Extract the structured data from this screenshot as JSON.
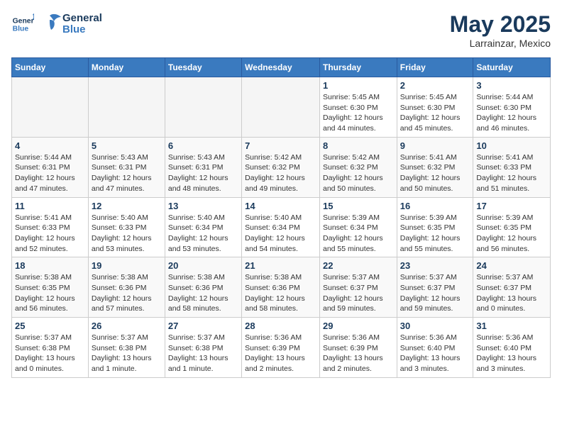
{
  "logo": {
    "line1": "General",
    "line2": "Blue"
  },
  "title": "May 2025",
  "location": "Larrainzar, Mexico",
  "weekdays": [
    "Sunday",
    "Monday",
    "Tuesday",
    "Wednesday",
    "Thursday",
    "Friday",
    "Saturday"
  ],
  "weeks": [
    [
      {
        "day": "",
        "empty": true
      },
      {
        "day": "",
        "empty": true
      },
      {
        "day": "",
        "empty": true
      },
      {
        "day": "",
        "empty": true
      },
      {
        "day": "1",
        "sunrise": "Sunrise: 5:45 AM",
        "sunset": "Sunset: 6:30 PM",
        "daylight": "Daylight: 12 hours and 44 minutes."
      },
      {
        "day": "2",
        "sunrise": "Sunrise: 5:45 AM",
        "sunset": "Sunset: 6:30 PM",
        "daylight": "Daylight: 12 hours and 45 minutes."
      },
      {
        "day": "3",
        "sunrise": "Sunrise: 5:44 AM",
        "sunset": "Sunset: 6:30 PM",
        "daylight": "Daylight: 12 hours and 46 minutes."
      }
    ],
    [
      {
        "day": "4",
        "sunrise": "Sunrise: 5:44 AM",
        "sunset": "Sunset: 6:31 PM",
        "daylight": "Daylight: 12 hours and 47 minutes."
      },
      {
        "day": "5",
        "sunrise": "Sunrise: 5:43 AM",
        "sunset": "Sunset: 6:31 PM",
        "daylight": "Daylight: 12 hours and 47 minutes."
      },
      {
        "day": "6",
        "sunrise": "Sunrise: 5:43 AM",
        "sunset": "Sunset: 6:31 PM",
        "daylight": "Daylight: 12 hours and 48 minutes."
      },
      {
        "day": "7",
        "sunrise": "Sunrise: 5:42 AM",
        "sunset": "Sunset: 6:32 PM",
        "daylight": "Daylight: 12 hours and 49 minutes."
      },
      {
        "day": "8",
        "sunrise": "Sunrise: 5:42 AM",
        "sunset": "Sunset: 6:32 PM",
        "daylight": "Daylight: 12 hours and 50 minutes."
      },
      {
        "day": "9",
        "sunrise": "Sunrise: 5:41 AM",
        "sunset": "Sunset: 6:32 PM",
        "daylight": "Daylight: 12 hours and 50 minutes."
      },
      {
        "day": "10",
        "sunrise": "Sunrise: 5:41 AM",
        "sunset": "Sunset: 6:33 PM",
        "daylight": "Daylight: 12 hours and 51 minutes."
      }
    ],
    [
      {
        "day": "11",
        "sunrise": "Sunrise: 5:41 AM",
        "sunset": "Sunset: 6:33 PM",
        "daylight": "Daylight: 12 hours and 52 minutes."
      },
      {
        "day": "12",
        "sunrise": "Sunrise: 5:40 AM",
        "sunset": "Sunset: 6:33 PM",
        "daylight": "Daylight: 12 hours and 53 minutes."
      },
      {
        "day": "13",
        "sunrise": "Sunrise: 5:40 AM",
        "sunset": "Sunset: 6:34 PM",
        "daylight": "Daylight: 12 hours and 53 minutes."
      },
      {
        "day": "14",
        "sunrise": "Sunrise: 5:40 AM",
        "sunset": "Sunset: 6:34 PM",
        "daylight": "Daylight: 12 hours and 54 minutes."
      },
      {
        "day": "15",
        "sunrise": "Sunrise: 5:39 AM",
        "sunset": "Sunset: 6:34 PM",
        "daylight": "Daylight: 12 hours and 55 minutes."
      },
      {
        "day": "16",
        "sunrise": "Sunrise: 5:39 AM",
        "sunset": "Sunset: 6:35 PM",
        "daylight": "Daylight: 12 hours and 55 minutes."
      },
      {
        "day": "17",
        "sunrise": "Sunrise: 5:39 AM",
        "sunset": "Sunset: 6:35 PM",
        "daylight": "Daylight: 12 hours and 56 minutes."
      }
    ],
    [
      {
        "day": "18",
        "sunrise": "Sunrise: 5:38 AM",
        "sunset": "Sunset: 6:35 PM",
        "daylight": "Daylight: 12 hours and 56 minutes."
      },
      {
        "day": "19",
        "sunrise": "Sunrise: 5:38 AM",
        "sunset": "Sunset: 6:36 PM",
        "daylight": "Daylight: 12 hours and 57 minutes."
      },
      {
        "day": "20",
        "sunrise": "Sunrise: 5:38 AM",
        "sunset": "Sunset: 6:36 PM",
        "daylight": "Daylight: 12 hours and 58 minutes."
      },
      {
        "day": "21",
        "sunrise": "Sunrise: 5:38 AM",
        "sunset": "Sunset: 6:36 PM",
        "daylight": "Daylight: 12 hours and 58 minutes."
      },
      {
        "day": "22",
        "sunrise": "Sunrise: 5:37 AM",
        "sunset": "Sunset: 6:37 PM",
        "daylight": "Daylight: 12 hours and 59 minutes."
      },
      {
        "day": "23",
        "sunrise": "Sunrise: 5:37 AM",
        "sunset": "Sunset: 6:37 PM",
        "daylight": "Daylight: 12 hours and 59 minutes."
      },
      {
        "day": "24",
        "sunrise": "Sunrise: 5:37 AM",
        "sunset": "Sunset: 6:37 PM",
        "daylight": "Daylight: 13 hours and 0 minutes."
      }
    ],
    [
      {
        "day": "25",
        "sunrise": "Sunrise: 5:37 AM",
        "sunset": "Sunset: 6:38 PM",
        "daylight": "Daylight: 13 hours and 0 minutes."
      },
      {
        "day": "26",
        "sunrise": "Sunrise: 5:37 AM",
        "sunset": "Sunset: 6:38 PM",
        "daylight": "Daylight: 13 hours and 1 minute."
      },
      {
        "day": "27",
        "sunrise": "Sunrise: 5:37 AM",
        "sunset": "Sunset: 6:38 PM",
        "daylight": "Daylight: 13 hours and 1 minute."
      },
      {
        "day": "28",
        "sunrise": "Sunrise: 5:36 AM",
        "sunset": "Sunset: 6:39 PM",
        "daylight": "Daylight: 13 hours and 2 minutes."
      },
      {
        "day": "29",
        "sunrise": "Sunrise: 5:36 AM",
        "sunset": "Sunset: 6:39 PM",
        "daylight": "Daylight: 13 hours and 2 minutes."
      },
      {
        "day": "30",
        "sunrise": "Sunrise: 5:36 AM",
        "sunset": "Sunset: 6:40 PM",
        "daylight": "Daylight: 13 hours and 3 minutes."
      },
      {
        "day": "31",
        "sunrise": "Sunrise: 5:36 AM",
        "sunset": "Sunset: 6:40 PM",
        "daylight": "Daylight: 13 hours and 3 minutes."
      }
    ]
  ]
}
